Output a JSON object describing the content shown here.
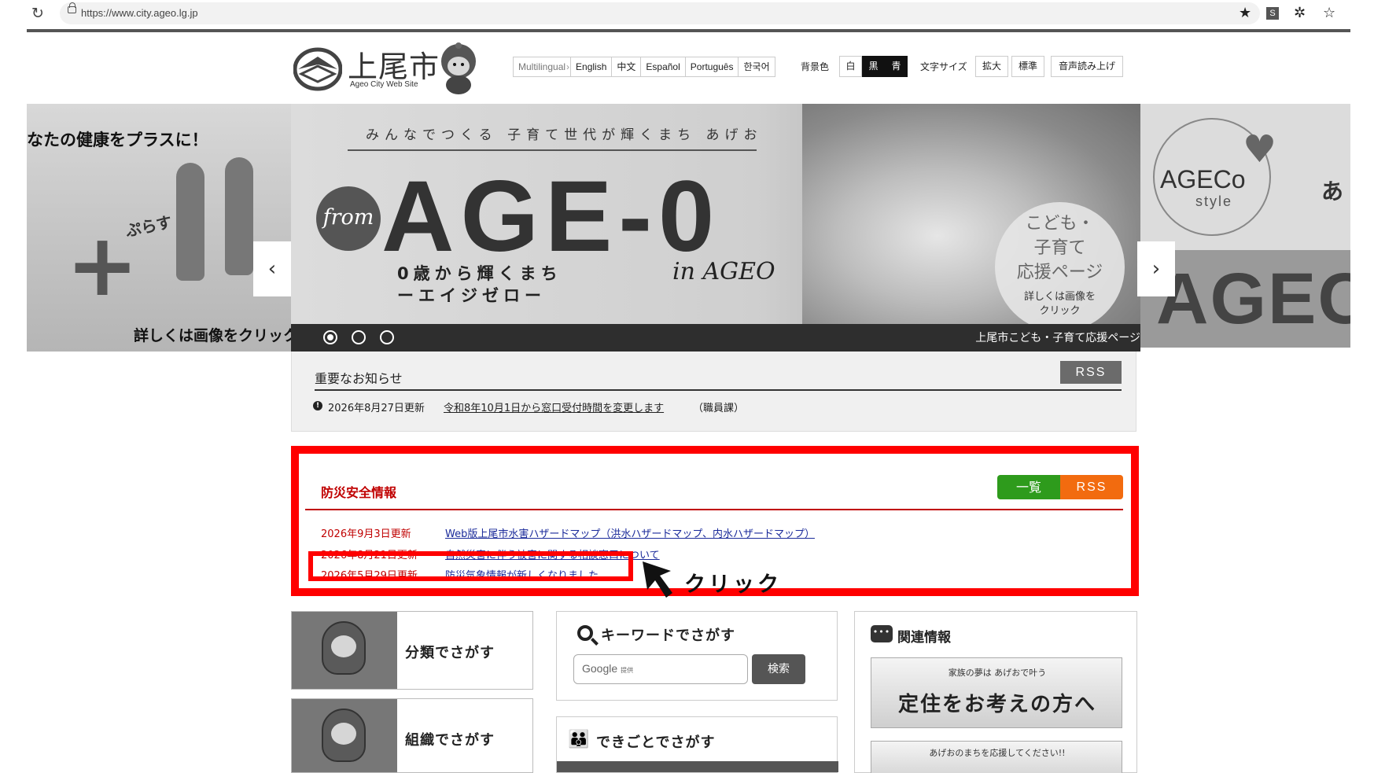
{
  "browser": {
    "url": "https://www.city.ageo.lg.jp",
    "ext_label": "S"
  },
  "header": {
    "logo_text": "上尾市",
    "logo_sub": "Ageo City Web Site",
    "languages": [
      "Multilingual",
      "English",
      "中文",
      "Español",
      "Português",
      "한국어"
    ],
    "bg_label": "背景色",
    "bg_options": [
      "白",
      "黒",
      "青"
    ],
    "fontsize_label": "文字サイズ",
    "fontsize_options": [
      "拡大",
      "標準"
    ],
    "speech_label": "音声読み上げ"
  },
  "carousel": {
    "prev": "‹",
    "next": "›",
    "left_slide": {
      "headline": "なたの健康をプラスに！",
      "plus_text": "ぷらす",
      "click_text": "詳しくは画像をクリック"
    },
    "main_slide": {
      "tagline": "みんなでつくる 子育て世代が輝くまち あげお",
      "from": "from",
      "big_text": "AGE-0",
      "sub1": "0歳から輝くまち",
      "sub2": "ーエイジゼロー",
      "in_ageo": "in AGEO",
      "badge_main": [
        "こども・",
        "子育て",
        "応援ページ"
      ],
      "badge_sub": [
        "詳しくは画像を",
        "クリック"
      ],
      "caption": "上尾市こども・子育て応援ページ",
      "active_dot": 1
    },
    "right_slide": {
      "ageco": "AGECo",
      "style": "style",
      "a_char": "あ",
      "ageco_big": "AGEC"
    }
  },
  "notice": {
    "title": "重要なお知らせ",
    "rss": "RSS",
    "date": "2026年8月27日更新",
    "link": "令和8年10月1日から窓口受付時間を変更します",
    "dept": "（職員課）"
  },
  "disaster": {
    "title": "防災安全情報",
    "list_btn": "一覧",
    "rss": "RSS",
    "items": [
      {
        "date": "2026年9月3日更新",
        "link": "Web版上尾市水害ハザードマップ（洪水ハザードマップ、内水ハザードマップ）"
      },
      {
        "date": "2026年8月21日更新",
        "link": "自然災害に伴う被害に関する相談窓口について"
      },
      {
        "date": "2026年5月29日更新",
        "link": "防災気象情報が新しくなりました"
      }
    ]
  },
  "annotation": {
    "click_label": "クリック"
  },
  "cards": {
    "category": "分類でさがす",
    "organization": "組織でさがす",
    "keyword_title": "キーワードでさがす",
    "keyword_placeholder": "Google",
    "keyword_provided": "提供",
    "search_btn": "検索",
    "dekigoto": "できごとでさがす",
    "related_title": "関連情報",
    "banner1_small": "家族の夢は あげおで叶う",
    "banner1_big": "定住をお考えの方へ",
    "banner2_small": "あげおのまちを応援してください!!"
  },
  "colors": {
    "alert_red": "#ff0000",
    "title_red": "#c00000",
    "link_blue": "#1a2a9a",
    "list_green": "#2e9b1c",
    "rss_orange": "#f26b0f"
  }
}
